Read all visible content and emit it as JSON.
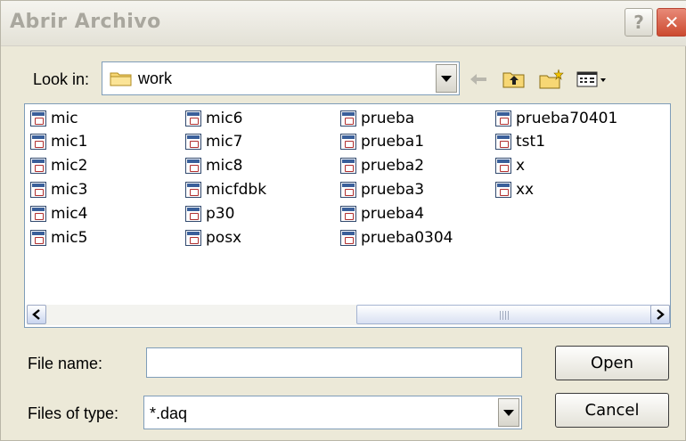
{
  "window": {
    "title": "Abrir Archivo",
    "help_label": "?",
    "close_label": "✕"
  },
  "lookin": {
    "label": "Look in:",
    "value": "work"
  },
  "files": [
    {
      "name": "mic"
    },
    {
      "name": "mic1"
    },
    {
      "name": "mic2"
    },
    {
      "name": "mic3"
    },
    {
      "name": "mic4"
    },
    {
      "name": "mic5"
    },
    {
      "name": "mic6"
    },
    {
      "name": "mic7"
    },
    {
      "name": "mic8"
    },
    {
      "name": "micfdbk"
    },
    {
      "name": "p30"
    },
    {
      "name": "posx"
    },
    {
      "name": "prueba"
    },
    {
      "name": "prueba1"
    },
    {
      "name": "prueba2"
    },
    {
      "name": "prueba3"
    },
    {
      "name": "prueba4"
    },
    {
      "name": "prueba0304"
    },
    {
      "name": "prueba70401"
    },
    {
      "name": "tst1"
    },
    {
      "name": "x"
    },
    {
      "name": "xx"
    }
  ],
  "scrollbar": {
    "left_arrow": "<",
    "right_arrow": ">"
  },
  "filename": {
    "label": "File name:",
    "value": ""
  },
  "filetype": {
    "label": "Files of type:",
    "value": "*.daq"
  },
  "buttons": {
    "open": "Open",
    "cancel": "Cancel"
  },
  "colors": {
    "dialog_bg": "#ece9d8",
    "close_red": "#cc4a2f",
    "border_blue": "#7f9db9"
  }
}
